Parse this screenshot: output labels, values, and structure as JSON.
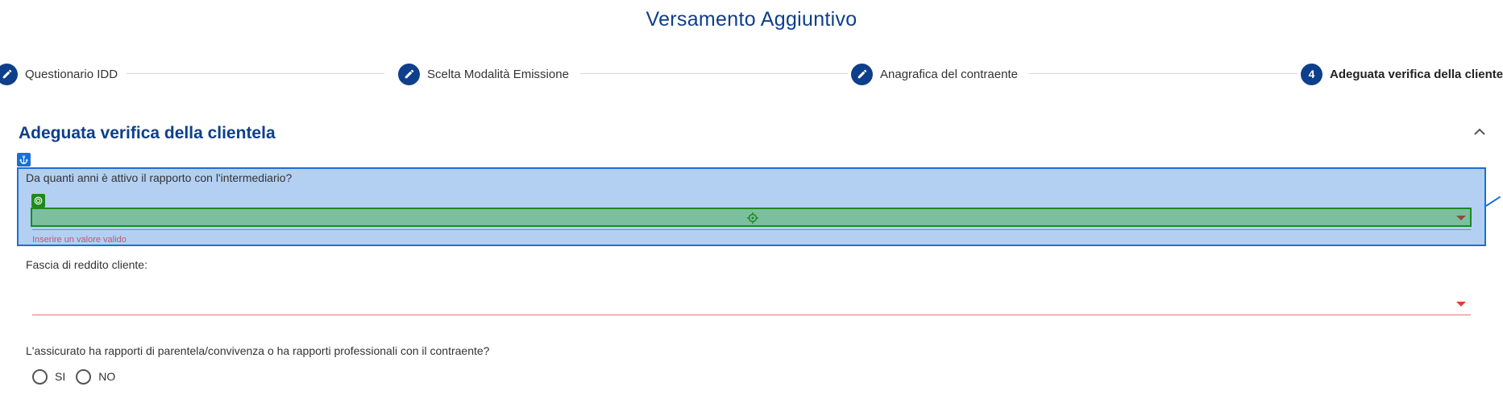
{
  "page": {
    "title": "Versamento Aggiuntivo"
  },
  "stepper": {
    "steps": [
      {
        "label": "Questionario IDD",
        "icon": "pencil-icon"
      },
      {
        "label": "Scelta Modalità Emissione",
        "icon": "pencil-icon"
      },
      {
        "label": "Anagrafica del contraente",
        "icon": "pencil-icon"
      },
      {
        "label": "Adeguata verifica della clientela",
        "number": "4"
      }
    ]
  },
  "section": {
    "title": "Adeguata verifica della clientela",
    "collapse_icon": "chevron-up-icon"
  },
  "fields": {
    "years_relationship": {
      "label": "Da quanti anni è attivo il rapporto con l'intermediario?",
      "value": "",
      "error": "Inserire un valore valido"
    },
    "income_band": {
      "label": "Fascia di reddito cliente:",
      "value": ""
    },
    "relationship_question": {
      "label": "L'assicurato ha rapporti di parentela/convivenza o ha rapporti professionali con il contraente?",
      "options": [
        "SI",
        "NO"
      ]
    }
  },
  "colors": {
    "primary": "#0e3f8a",
    "highlight_blue": "#1a6fd6",
    "highlight_green": "#1e8a1e",
    "error": "#c0566c"
  }
}
